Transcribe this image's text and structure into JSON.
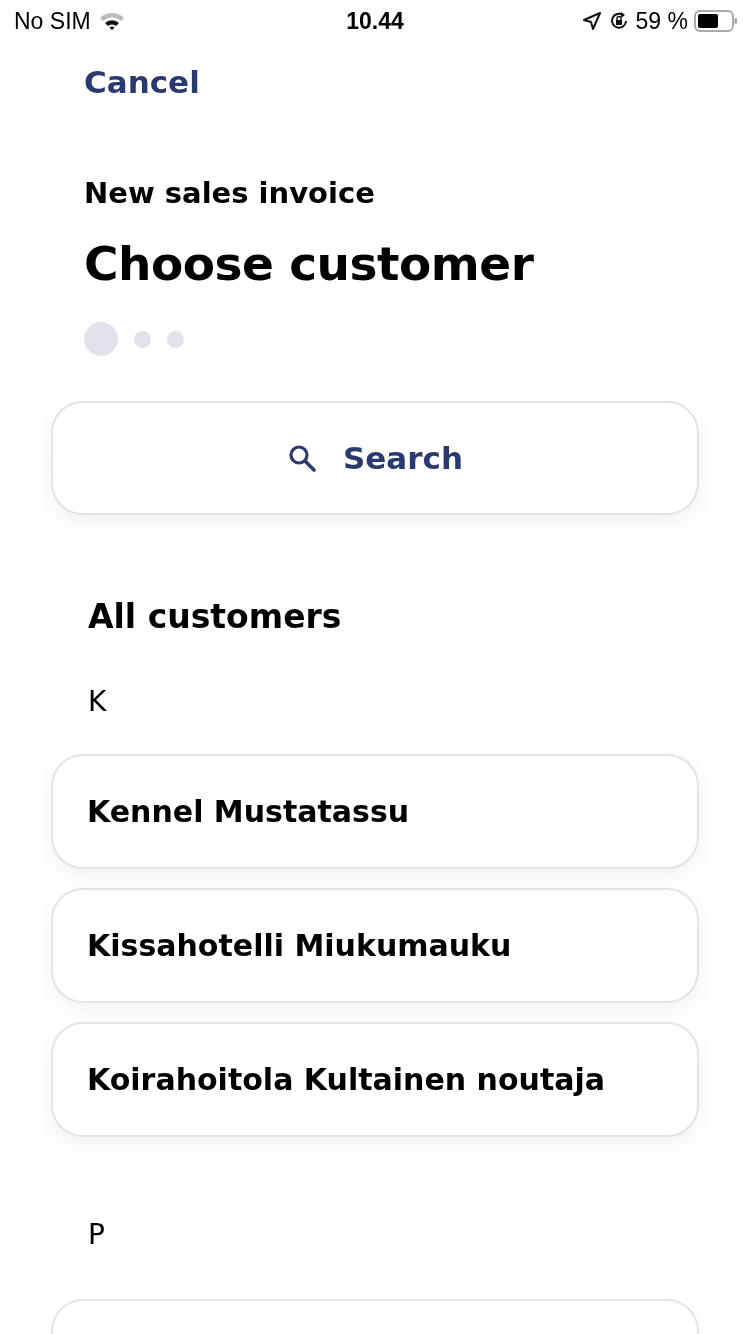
{
  "status_bar": {
    "carrier": "No SIM",
    "time": "10.44",
    "battery_text": "59 %"
  },
  "cancel": "Cancel",
  "subtitle": "New sales invoice",
  "title": "Choose customer",
  "steps": [
    {
      "selected": true
    },
    {
      "selected": false
    },
    {
      "selected": false
    }
  ],
  "search": {
    "label": "Search"
  },
  "section_title": "All customers",
  "groups": [
    {
      "letter": "K",
      "items": [
        {
          "name": "Kennel Mustatassu"
        },
        {
          "name": "Kissahotelli Miukumauku"
        },
        {
          "name": "Koirahoitola Kultainen noutaja"
        }
      ],
      "more_below": false
    },
    {
      "letter": "P",
      "more_below": true
    }
  ]
}
